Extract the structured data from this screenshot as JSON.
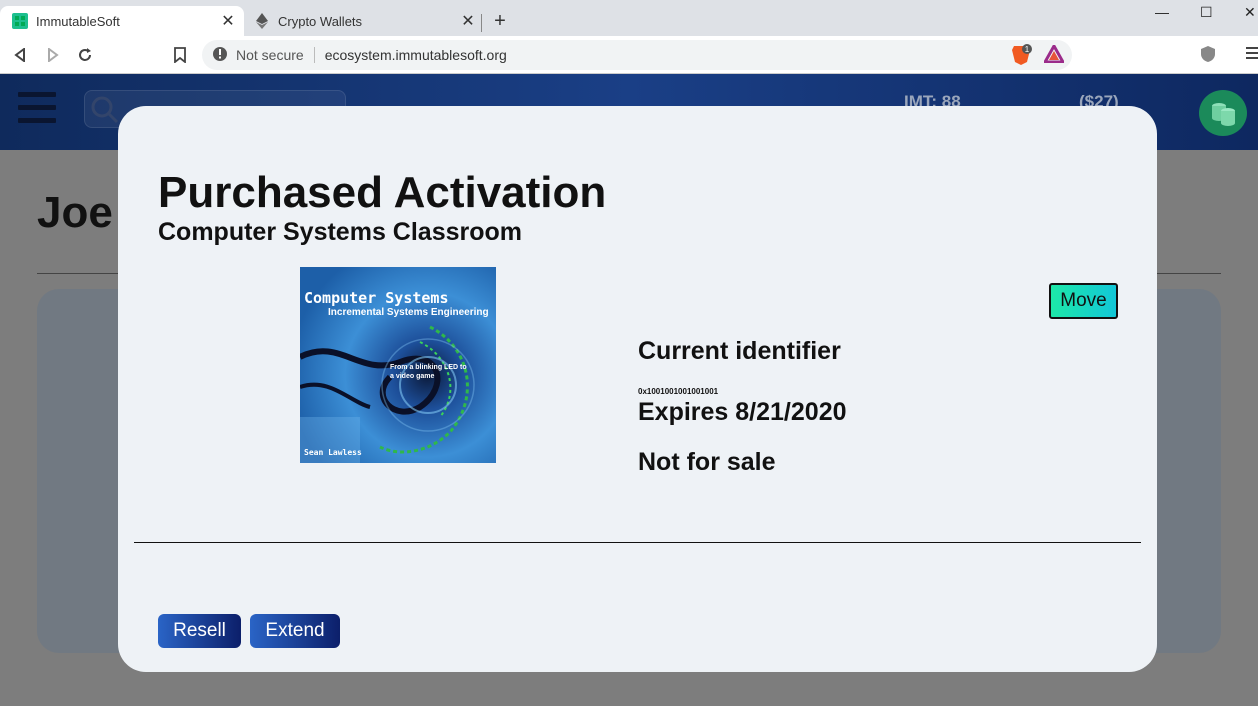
{
  "browser": {
    "tabs": [
      {
        "title": "ImmutableSoft",
        "active": true,
        "icon": "immutablesoft-favicon"
      },
      {
        "title": "Crypto Wallets",
        "active": false,
        "icon": "ethereum-icon"
      }
    ],
    "security_label": "Not secure",
    "url": "ecosystem.immutablesoft.org",
    "brave_badge": "1"
  },
  "app": {
    "imt_balance": "IMT: 88",
    "usd_value": "($27)",
    "page_name": "Joe"
  },
  "modal": {
    "title": "Purchased Activation",
    "subtitle": "Computer Systems Classroom",
    "cover": {
      "title": "Computer Systems",
      "subtitle": "Incremental Systems Engineering",
      "blurb": "From a blinking LED to a video game",
      "author": "Sean Lawless"
    },
    "move_label": "Move",
    "identifier_label": "Current identifier",
    "identifier_value": "0x1001001001001001",
    "expires": "Expires 8/21/2020",
    "sale_status": "Not for sale",
    "resell_label": "Resell",
    "extend_label": "Extend"
  },
  "colors": {
    "header_blue": "#1a3f86",
    "move_accent": "#1de8a8",
    "button_blue": "#2a64c6",
    "modal_bg": "#eef2f6"
  }
}
